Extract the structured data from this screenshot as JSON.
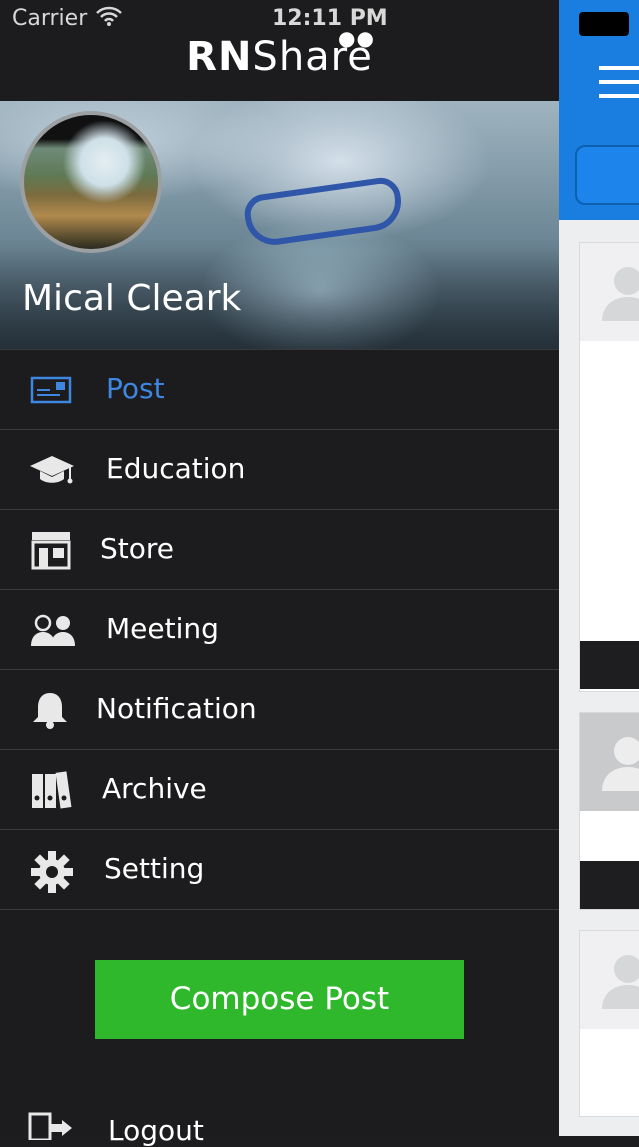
{
  "status_bar": {
    "carrier": "Carrier",
    "time": "12:11 PM"
  },
  "app": {
    "logo_bold": "RN",
    "logo_light": "Share"
  },
  "profile": {
    "name": "Mical Cleark"
  },
  "menu": [
    {
      "label": "Post",
      "icon": "post-icon",
      "active": true
    },
    {
      "label": "Education",
      "icon": "graduation-cap-icon"
    },
    {
      "label": "Store",
      "icon": "store-icon"
    },
    {
      "label": "Meeting",
      "icon": "meeting-icon"
    },
    {
      "label": "Notification",
      "icon": "bell-icon"
    },
    {
      "label": "Archive",
      "icon": "archive-icon"
    },
    {
      "label": "Setting",
      "icon": "gear-icon"
    }
  ],
  "compose_button": "Compose Post",
  "logout": {
    "label": "Logout",
    "icon": "logout-icon"
  },
  "colors": {
    "accent": "#3f86e0",
    "compose": "#2fb82c",
    "drawer_bg": "#1c1c1e",
    "header_blue": "#1a7de0"
  }
}
